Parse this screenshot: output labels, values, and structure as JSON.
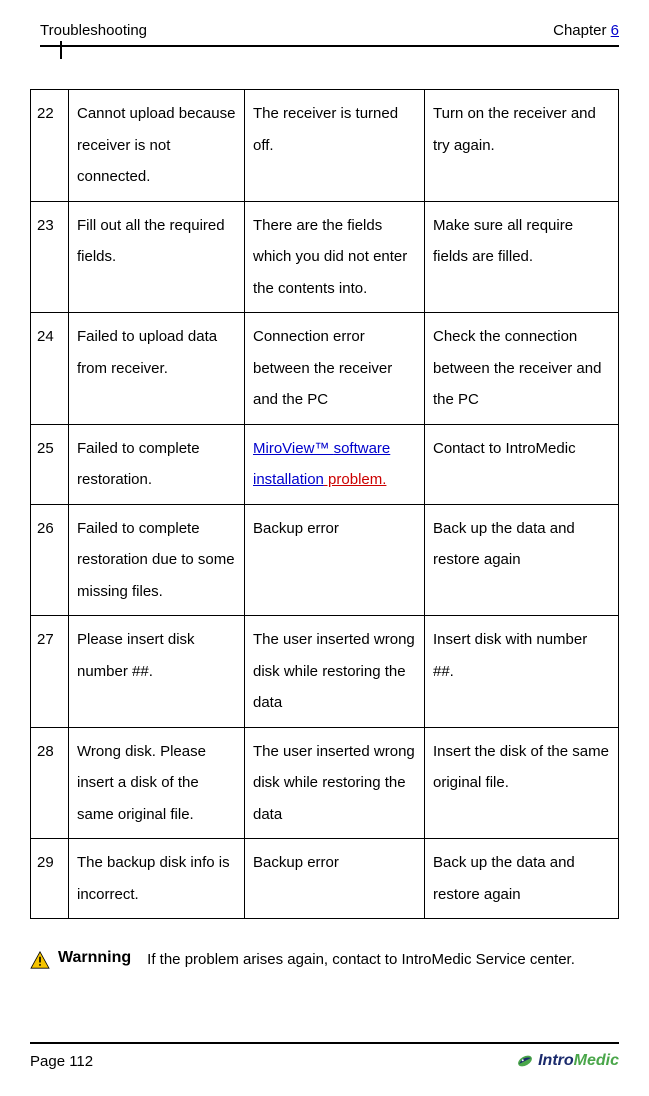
{
  "header": {
    "left": "Troubleshooting",
    "chapter_label": "Chapter ",
    "chapter_num": "6"
  },
  "rows": [
    {
      "n": "22",
      "msg": "Cannot upload because receiver is not connected.",
      "cause": "The receiver is turned off.",
      "action": "Turn on the receiver and try again."
    },
    {
      "n": "23",
      "msg": "Fill out all the required fields.",
      "cause": "There are the fields which you did not enter the contents into.",
      "action": "Make sure all require fields are filled."
    },
    {
      "n": "24",
      "msg": "Failed to upload data from receiver.",
      "cause": "Connection error between the receiver and the PC",
      "action": "Check the connection between the receiver and the PC"
    },
    {
      "n": "25",
      "msg": "Failed to complete restoration.",
      "cause_link1": "MiroView™ ",
      "cause_link2": "software installation",
      "cause_red": " problem.",
      "action": "Contact to IntroMedic"
    },
    {
      "n": "26",
      "msg": "Failed to complete restoration due to some missing files.",
      "cause": "Backup error",
      "action": "Back up the data and restore again"
    },
    {
      "n": "27",
      "msg": "Please insert disk number ##.",
      "cause": "The user inserted wrong disk while restoring the data",
      "action": "Insert disk with number ##."
    },
    {
      "n": "28",
      "msg": "Wrong disk. Please insert a disk of the same original file.",
      "cause": "The user inserted wrong disk while restoring the data",
      "action": "Insert the disk of the same original file."
    },
    {
      "n": "29",
      "msg": "The backup disk info is incorrect.",
      "cause": "Backup error",
      "action": "Back up the data and restore again"
    }
  ],
  "warning": {
    "label": "Warnning",
    "text": "If the problem arises again, contact to IntroMedic Service center."
  },
  "footer": {
    "page": "Page 112",
    "logo_intro": "Intro",
    "logo_medic": "Medic"
  }
}
